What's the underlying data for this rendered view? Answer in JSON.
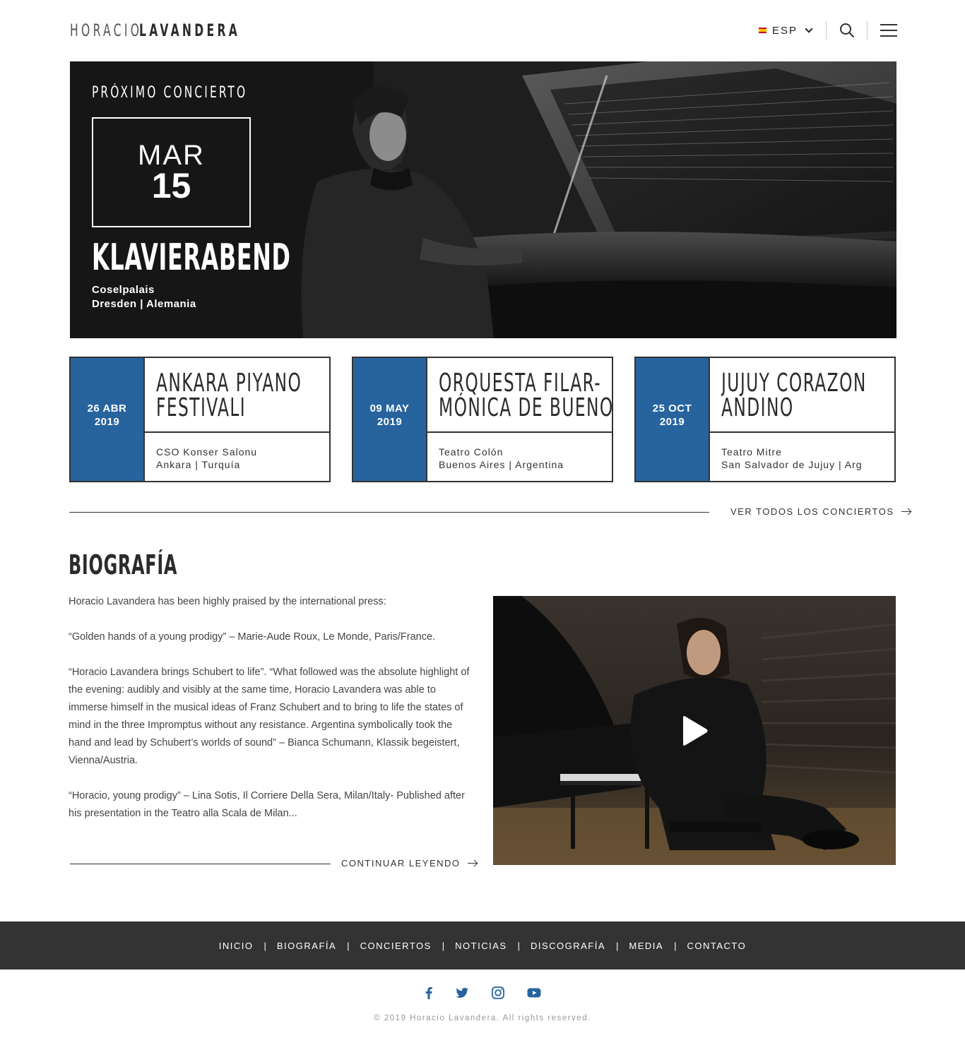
{
  "header": {
    "logo_first": "HORACIO",
    "logo_last": "LAVANDERA",
    "language": "ESP"
  },
  "hero": {
    "eyebrow": "PRÓXIMO CONCIERTO",
    "month": "MAR",
    "day": "15",
    "title": "KLAVIERABEND",
    "venue_line1": "Coselpalais",
    "venue_line2": "Dresden | Alemania"
  },
  "concerts": [
    {
      "date_line1": "26 ABR",
      "date_line2": "2019",
      "title_line1": "ANKARA PIYANO",
      "title_line2": "FESTIVALI",
      "venue_line1": "CSO Konser Salonu",
      "venue_line2": "Ankara | Turquía"
    },
    {
      "date_line1": "09 MAY",
      "date_line2": "2019",
      "title_line1": "ORQUESTA FILAR-",
      "title_line2": "MÓNICA DE BUENO...",
      "venue_line1": "Teatro Colón",
      "venue_line2": "Buenos Aires  | Argentina"
    },
    {
      "date_line1": "25 OCT",
      "date_line2": "2019",
      "title_line1": "JUJUY CORAZÓN",
      "title_line2": "ANDINO",
      "venue_line1": "Teatro Mitre",
      "venue_line2": "San Salvador de Jujuy | Arg"
    }
  ],
  "view_all": "VER TODOS LOS CONCIERTOS",
  "bio": {
    "heading": "BIOGRAFÍA",
    "paragraphs": [
      "Horacio Lavandera has been highly praised by the international press:",
      "“Golden hands of a young prodigy” – Marie-Aude Roux, Le Monde, Paris/France.",
      "“Horacio Lavandera brings Schubert to life”. “What followed was the absolute highlight of the evening: audibly and visibly at the same time, Horacio Lavandera was able to immerse himself in the musical ideas of Franz Schubert and to bring to life the states of mind in the three Impromptus without any resistance. Argentina symbolically took the hand and lead by Schubert’s worlds of sound” – Bianca Schumann, Klassik begeistert,  Vienna/Austria.",
      "“Horacio, young prodigy” – Lina Sotis, Il Corriere Della Sera, Milan/Italy- Published after his presentation in the Teatro alla Scala de Milan..."
    ],
    "read_more": "CONTINUAR LEYENDO"
  },
  "footer": {
    "nav": [
      "INICIO",
      "BIOGRAFÍA",
      "CONCIERTOS",
      "NOTICIAS",
      "DISCOGRAFÍA",
      "MEDIA",
      "CONTACTO"
    ],
    "social": [
      "facebook-icon",
      "twitter-icon",
      "instagram-icon",
      "youtube-icon"
    ],
    "copyright": "© 2019 Horacio Lavandera. All rights reserved."
  },
  "colors": {
    "accent": "#27649e",
    "footer_bg": "#333333",
    "text": "#333333"
  }
}
